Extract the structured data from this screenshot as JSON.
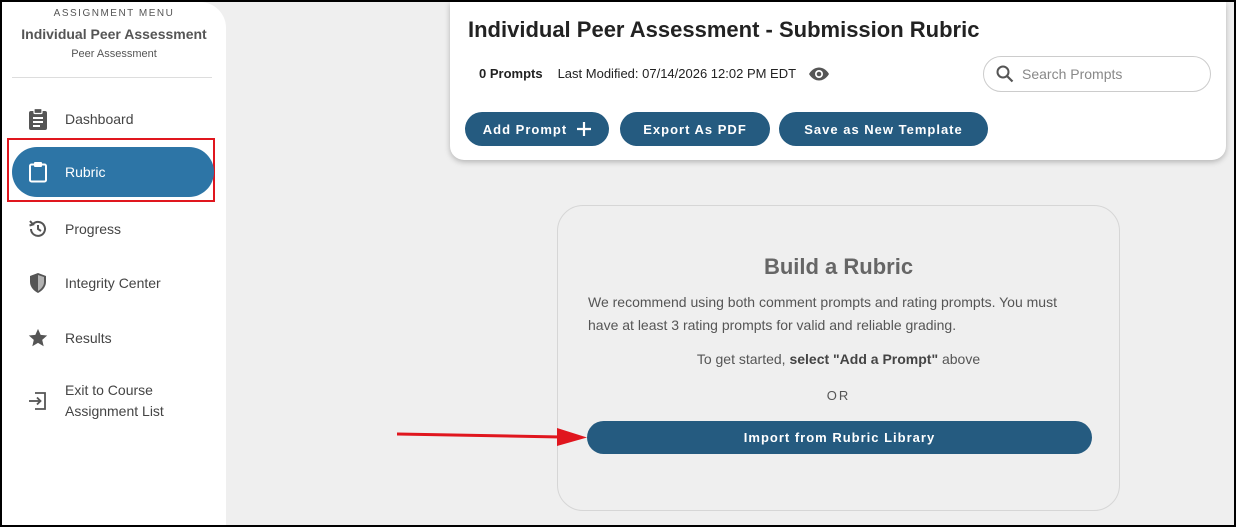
{
  "sidebar": {
    "caption": "ASSIGNMENT MENU",
    "title": "Individual Peer Assessment",
    "subtitle": "Peer Assessment",
    "items": [
      {
        "label": "Dashboard",
        "icon": "clipboard-list-icon"
      },
      {
        "label": "Rubric",
        "icon": "clipboard-icon",
        "active": true
      },
      {
        "label": "Progress",
        "icon": "clock-history-icon"
      },
      {
        "label": "Integrity Center",
        "icon": "shield-icon"
      },
      {
        "label": "Results",
        "icon": "star-icon"
      },
      {
        "label_line1": "Exit to Course",
        "label_line2": "Assignment List",
        "icon": "exit-icon"
      }
    ]
  },
  "header": {
    "title": "Individual Peer Assessment - Submission Rubric",
    "prompt_count": "0 Prompts",
    "last_modified": "Last Modified: 07/14/2026 12:02 PM EDT",
    "search_placeholder": "Search Prompts",
    "buttons": {
      "add_prompt": "Add Prompt",
      "export_pdf": "Export As PDF",
      "save_template": "Save as New Template"
    }
  },
  "build": {
    "title": "Build a Rubric",
    "description": "We recommend using both comment prompts and rating prompts. You must have at least 3 rating prompts for valid and reliable grading.",
    "start_prefix": "To get started, ",
    "start_bold": "select \"Add a Prompt\"",
    "start_suffix": " above",
    "or": "OR",
    "import_label": "Import from Rubric Library"
  },
  "colors": {
    "primary": "#255b80",
    "active_nav": "#2d75a6",
    "highlight": "#e0161e",
    "background": "#efefef"
  }
}
